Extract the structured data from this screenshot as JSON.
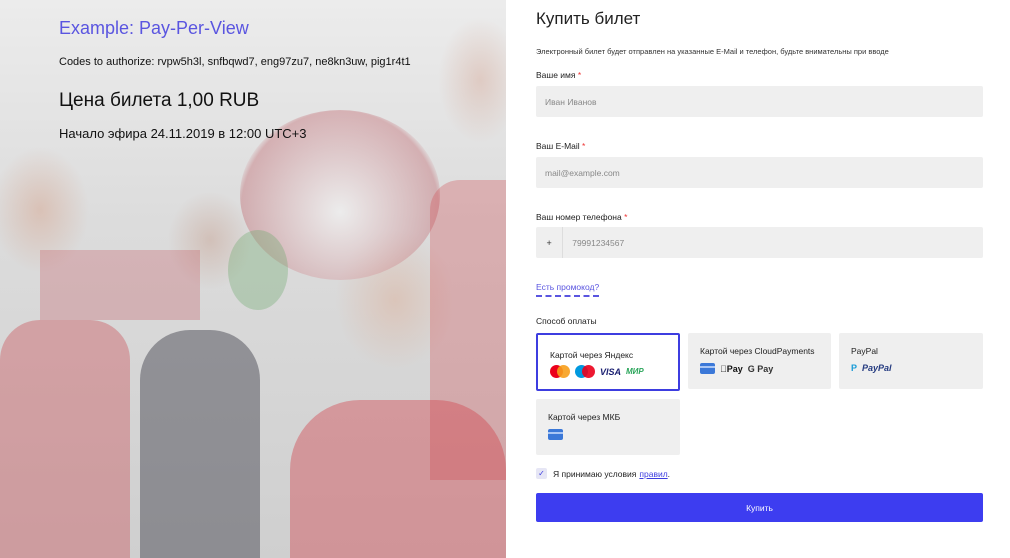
{
  "left": {
    "title": "Example: Pay-Per-View",
    "codes": "Codes to authorize: rvpw5h3l, snfbqwd7, eng97zu7, ne8kn3uw, pig1r4t1",
    "price": "Цена билета 1,00 RUB",
    "start": "Начало эфира 24.11.2019 в 12:00 UTC+3"
  },
  "form": {
    "title": "Купить билет",
    "notice": "Электронный билет будет отправлен на указанные E-Mail и телефон, будьте внимательны при вводе",
    "name_label": "Ваше имя",
    "name_placeholder": "Иван Иванов",
    "email_label": "Ваш E-Mail",
    "email_placeholder": "mail@example.com",
    "phone_label": "Ваш номер телефона",
    "phone_prefix": "+",
    "phone_placeholder": "79991234567",
    "required_mark": "*",
    "promo_link": "Есть промокод?",
    "payment_label": "Способ оплаты",
    "payment_methods": [
      {
        "name": "Картой через Яндекс",
        "selected": true,
        "icons": [
          "mastercard-icon",
          "maestro-icon",
          "VISA",
          "МИР"
        ]
      },
      {
        "name": "Картой через CloudPayments",
        "selected": false,
        "icons": [
          "card-icon",
          "Pay",
          "G Pay"
        ]
      },
      {
        "name": "PayPal",
        "selected": false,
        "icons": [
          "paypal-icon",
          "PayPal"
        ]
      },
      {
        "name": "Картой через МКБ",
        "selected": false,
        "icons": [
          "card-icon"
        ]
      }
    ],
    "agree_text": "Я принимаю условия",
    "agree_link": "правил",
    "agree_suffix": ".",
    "agree_checked": true,
    "buy_label": "Купить"
  },
  "colors": {
    "accent": "#3d3df0",
    "title_purple": "#5a55e0",
    "field_bg": "#efefef"
  }
}
